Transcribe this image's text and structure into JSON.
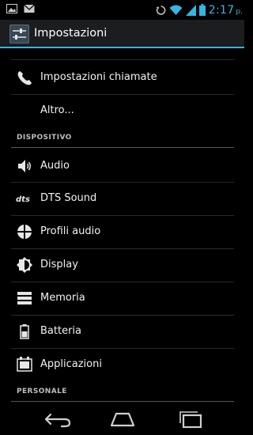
{
  "status": {
    "time": "2:17",
    "ampm": "p.",
    "icons": [
      "image-notification-icon",
      "email-notification-icon",
      "sync-icon",
      "wifi-icon",
      "signal-icon",
      "battery-icon"
    ],
    "accent_color": "#33b5e5"
  },
  "actionbar": {
    "title": "Impostazioni",
    "icon": "settings-sliders-icon"
  },
  "list": {
    "items": [
      {
        "label": "Impostazioni chiamate",
        "icon": "phone-icon"
      },
      {
        "label": "Altro...",
        "icon": ""
      }
    ],
    "sections": [
      {
        "header": "DISPOSITIVO",
        "items": [
          {
            "label": "Audio",
            "icon": "speaker-icon"
          },
          {
            "label": "DTS Sound",
            "icon": "dts-icon"
          },
          {
            "label": "Profili audio",
            "icon": "audio-profile-icon"
          },
          {
            "label": "Display",
            "icon": "brightness-icon"
          },
          {
            "label": "Memoria",
            "icon": "storage-icon"
          },
          {
            "label": "Batteria",
            "icon": "battery-icon"
          },
          {
            "label": "Applicazioni",
            "icon": "apps-icon"
          }
        ]
      },
      {
        "header": "PERSONALE",
        "items": []
      }
    ]
  },
  "navbar": {
    "buttons": [
      "back-icon",
      "home-icon",
      "recent-apps-icon"
    ]
  }
}
